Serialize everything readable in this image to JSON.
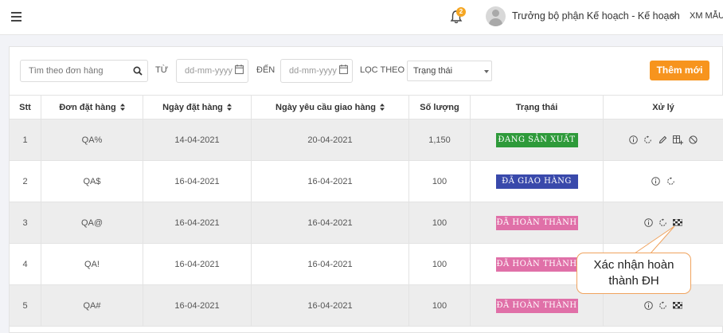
{
  "header": {
    "notification_count": "2",
    "user_name": "Trưởng bộ phận Kế hoạch - Kế hoạch",
    "org_name": "XM MẪU"
  },
  "filters": {
    "search_placeholder": "Tìm theo đơn hàng",
    "from_label": "TỪ",
    "from_placeholder": "dd-mm-yyyy",
    "to_label": "ĐẾN",
    "to_placeholder": "dd-mm-yyyy",
    "filter_label": "LỌC THEO",
    "filter_value": "Trạng thái",
    "add_button": "Thêm mới"
  },
  "table": {
    "columns": [
      "Stt",
      "Đơn đặt hàng",
      "Ngày đặt hàng",
      "Ngày yêu cầu giao hàng",
      "Số lượng",
      "Trạng thái",
      "Xử lý"
    ],
    "rows": [
      {
        "stt": "1",
        "order": "QA%",
        "order_date": "14-04-2021",
        "delivery_date": "20-04-2021",
        "qty": "1,150",
        "status": "ĐANG SẢN XUẤT",
        "status_color": "#2e9a3a"
      },
      {
        "stt": "2",
        "order": "QA$",
        "order_date": "16-04-2021",
        "delivery_date": "16-04-2021",
        "qty": "100",
        "status": "ĐÃ GIAO HÀNG",
        "status_color": "#3949ab"
      },
      {
        "stt": "3",
        "order": "QA@",
        "order_date": "16-04-2021",
        "delivery_date": "16-04-2021",
        "qty": "100",
        "status": "ĐÃ HOÀN THÀNH",
        "status_color": "#e070a8"
      },
      {
        "stt": "4",
        "order": "QA!",
        "order_date": "16-04-2021",
        "delivery_date": "16-04-2021",
        "qty": "100",
        "status": "ĐÃ HOÀN THÀNH",
        "status_color": "#e070a8"
      },
      {
        "stt": "5",
        "order": "QA#",
        "order_date": "16-04-2021",
        "delivery_date": "16-04-2021",
        "qty": "100",
        "status": "ĐÃ HOÀN THÀNH",
        "status_color": "#e070a8"
      }
    ]
  },
  "callout": {
    "line1": "Xác nhận hoàn",
    "line2": "thành ĐH"
  },
  "icons": {
    "menu": "hamburger-icon",
    "bell": "bell-icon",
    "search": "search-icon",
    "calendar": "calendar-icon",
    "info": "info-icon",
    "refresh": "refresh-icon",
    "edit": "pencil-icon",
    "add_table": "table-add-icon",
    "cancel": "ban-icon",
    "finish": "checkered-flag-icon"
  }
}
